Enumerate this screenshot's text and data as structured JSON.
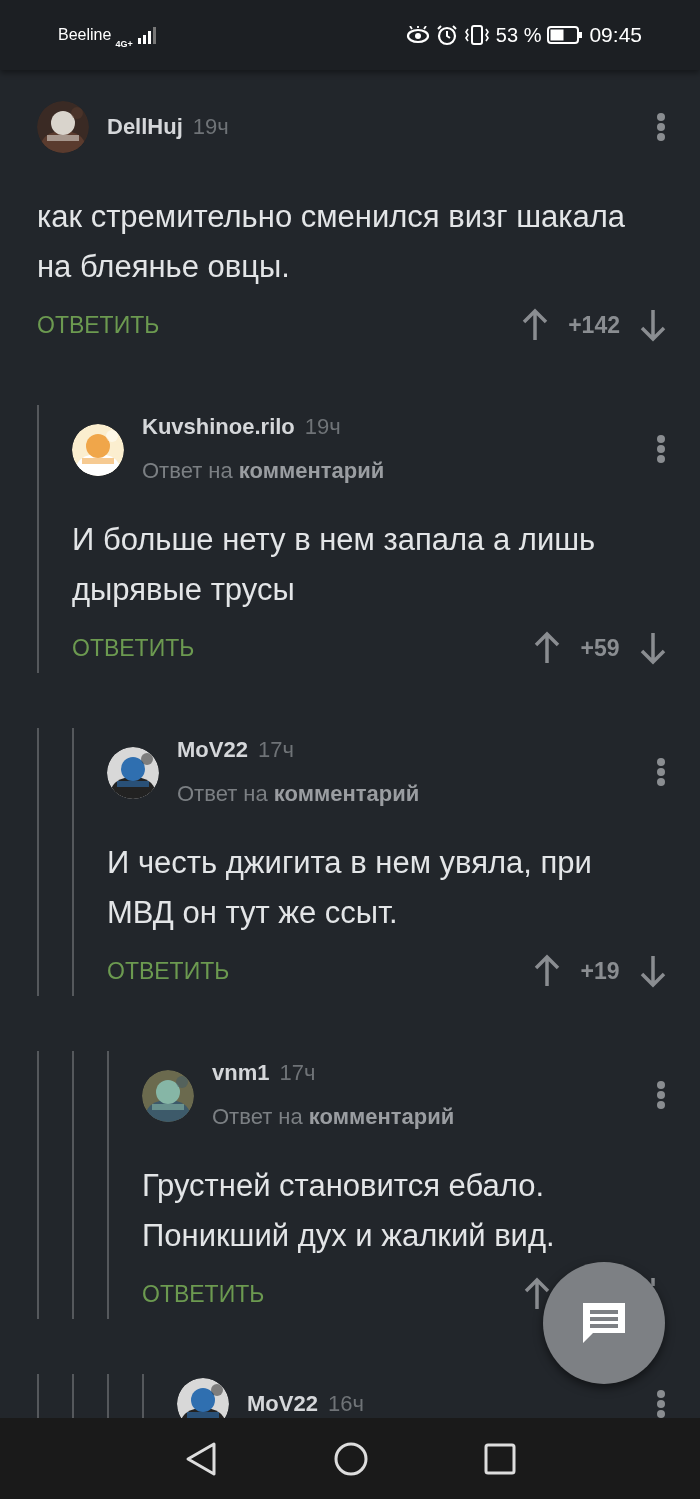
{
  "status_bar": {
    "carrier": "Beeline",
    "network": "4G+",
    "battery": "53 %",
    "time": "09:45"
  },
  "comments": [
    {
      "author": "DellHuj",
      "time": "19ч",
      "text": "как стремительно сменился визг шакала на блеянье овцы.",
      "reply_label": "ОТВЕТИТЬ",
      "rating": "+142",
      "children": [
        {
          "author": "Kuvshinoe.rilo",
          "time": "19ч",
          "reply_to": "Ответ на **комментарий**",
          "text": "И больше нету в нем запала а лишь дырявые трусы",
          "reply_label": "ОТВЕТИТЬ",
          "rating": "+59",
          "children": [
            {
              "author": "MoV22",
              "time": "17ч",
              "reply_to": "Ответ на **комментарий**",
              "text": "И честь джигита в нем увяла, при МВД он тут же ссыт.",
              "reply_label": "ОТВЕТИТЬ",
              "rating": "+19",
              "children": [
                {
                  "author": "vnm1",
                  "time": "17ч",
                  "reply_to": "Ответ на **комментарий**",
                  "text": "Грустней становится ебало. Поникший дух и жалкий вид.",
                  "reply_label": "ОТВЕТИТЬ",
                  "children": [
                    {
                      "author": "MoV22",
                      "time": "16ч"
                    }
                  ]
                }
              ]
            }
          ]
        }
      ]
    }
  ]
}
